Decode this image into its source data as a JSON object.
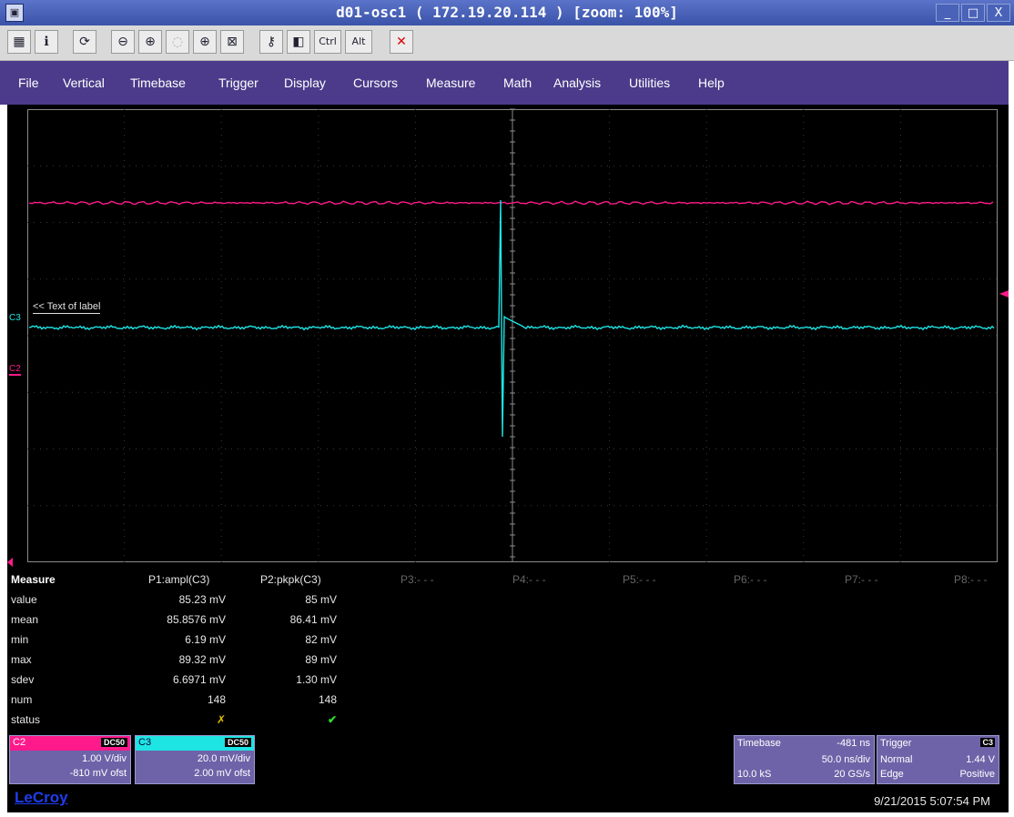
{
  "window": {
    "title": "d01-osc1 ( 172.19.20.114 ) [zoom: 100%]",
    "minimize": "_",
    "maximize": "□",
    "close": "X"
  },
  "toolbar": {
    "ctrl_label": "Ctrl",
    "alt_label": "Alt"
  },
  "menu": [
    "File",
    "Vertical",
    "Timebase",
    "Trigger",
    "Display",
    "Cursors",
    "Measure",
    "Math",
    "Analysis",
    "Utilities",
    "Help"
  ],
  "trace_label": "<< Text of label",
  "channel_markers": {
    "c3": "C3",
    "c2": "C2"
  },
  "measure": {
    "header": "Measure",
    "params": [
      "P1:ampl(C3)",
      "P2:pkpk(C3)",
      "P3:- - -",
      "P4:- - -",
      "P5:- - -",
      "P6:- - -",
      "P7:- - -",
      "P8:- - -"
    ],
    "rows": [
      {
        "name": "value",
        "p1": "85.23 mV",
        "p2": "85 mV"
      },
      {
        "name": "mean",
        "p1": "85.8576 mV",
        "p2": "86.41 mV"
      },
      {
        "name": "min",
        "p1": "6.19 mV",
        "p2": "82 mV"
      },
      {
        "name": "max",
        "p1": "89.32 mV",
        "p2": "89 mV"
      },
      {
        "name": "sdev",
        "p1": "6.6971 mV",
        "p2": "1.30 mV"
      },
      {
        "name": "num",
        "p1": "148",
        "p2": "148"
      },
      {
        "name": "status",
        "p1": "✗",
        "p2": "✔"
      }
    ]
  },
  "channels": [
    {
      "name": "C2",
      "coupling": "DC50",
      "vdiv": "1.00 V/div",
      "offset": "-810 mV ofst",
      "color": "#ff1a8c"
    },
    {
      "name": "C3",
      "coupling": "DC50",
      "vdiv": "20.0 mV/div",
      "offset": "2.00 mV ofst",
      "color": "#1ee4e4"
    }
  ],
  "timebase": {
    "label": "Timebase",
    "delay": "-481 ns",
    "tdiv": "50.0 ns/div",
    "samples": "10.0 kS",
    "rate": "20 GS/s"
  },
  "trigger": {
    "label": "Trigger",
    "source": "C3",
    "mode": "Normal",
    "level": "1.44 V",
    "type": "Edge",
    "slope": "Positive"
  },
  "brand": "LeCroy",
  "datetime": "9/21/2015 5:07:54 PM"
}
